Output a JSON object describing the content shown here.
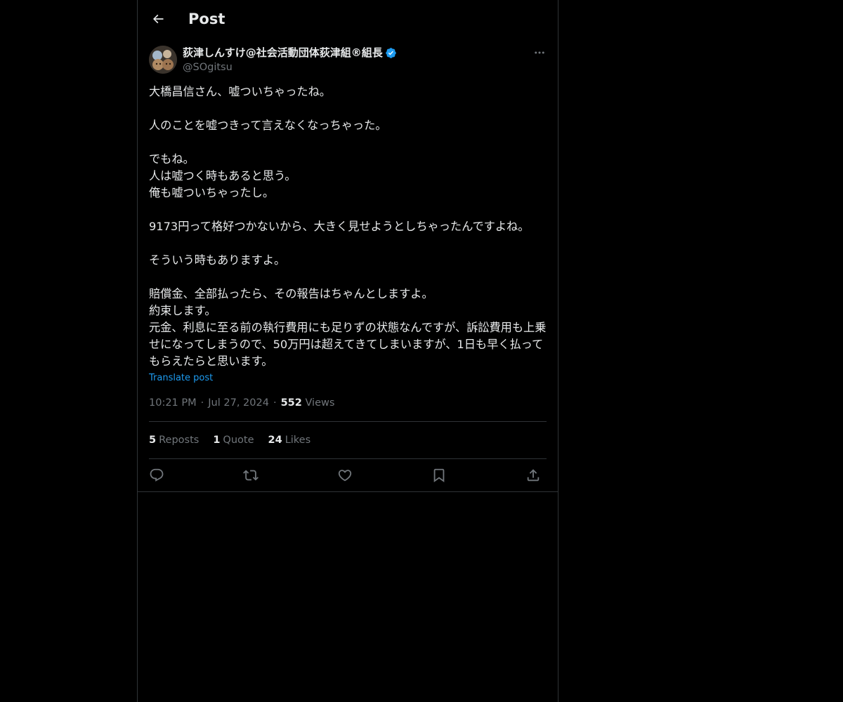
{
  "header": {
    "title": "Post",
    "back_icon": "arrow-left-icon"
  },
  "author": {
    "display_name": "荻津しんすけ@社会活動団体荻津組®組長",
    "handle": "@SOgitsu",
    "verified": true,
    "verified_color": "#1d9bf0"
  },
  "post": {
    "text": "大橋昌信さん、嘘ついちゃったね。\n\n人のことを嘘つきって言えなくなっちゃった。\n\nでもね。\n人は嘘つく時もあると思う。\n俺も嘘ついちゃったし。\n\n9173円って格好つかないから、大きく見せようとしちゃったんですよね。\n\nそういう時もありますよ。\n\n賠償金、全部払ったら、その報告はちゃんとしますよ。\n約束します。\n元金、利息に至る前の執行費用にも足りずの状態なんですが、訴訟費用も上乗せになってしまうので、50万円は超えてきてしまいますが、1日も早く払ってもらえたらと思います。",
    "translate_label": "Translate post",
    "time": "10:21 PM",
    "date": "Jul 27, 2024",
    "views_count": "552",
    "views_label": "Views"
  },
  "stats": {
    "reposts_count": "5",
    "reposts_label": "Reposts",
    "quotes_count": "1",
    "quotes_label": "Quote",
    "likes_count": "24",
    "likes_label": "Likes"
  },
  "actions": [
    "reply-icon",
    "repost-icon",
    "like-icon",
    "bookmark-icon",
    "share-icon"
  ],
  "colors": {
    "background": "#000000",
    "text": "#e7e9ea",
    "secondary": "#71767b",
    "border": "#2f3336",
    "accent": "#1d9bf0"
  }
}
